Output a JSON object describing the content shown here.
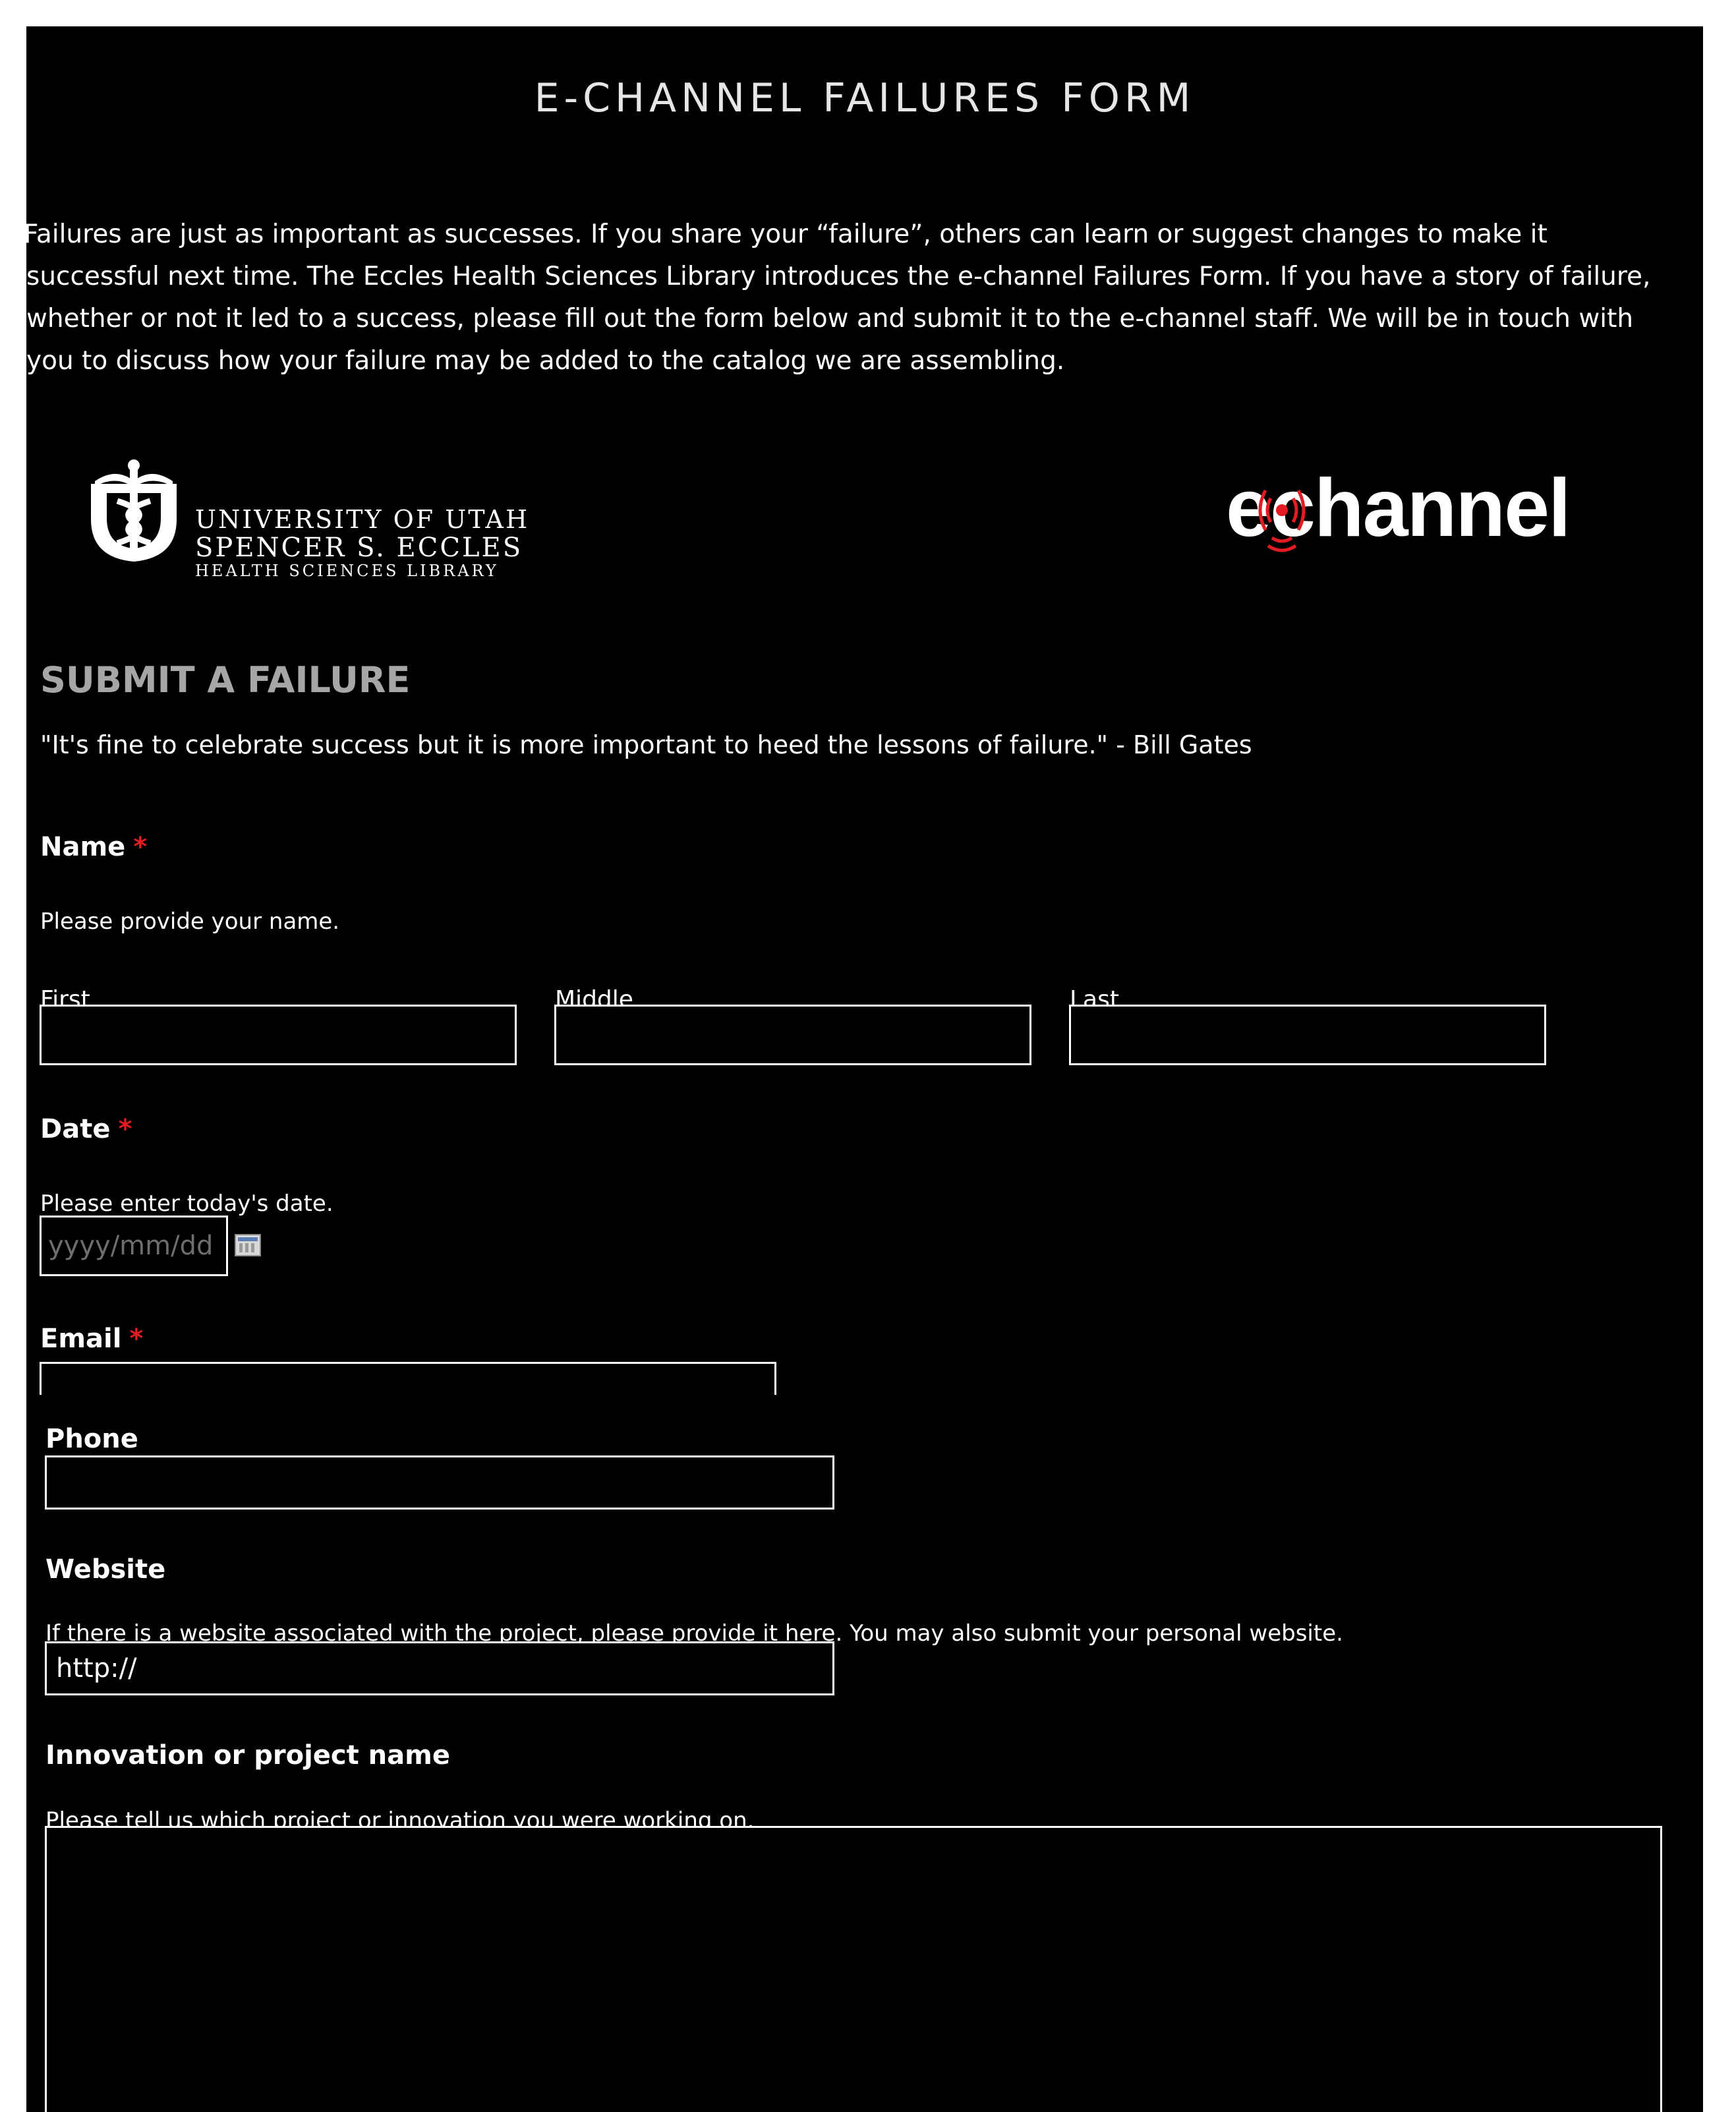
{
  "header": {
    "title": "E-CHANNEL FAILURES FORM",
    "intro": "Failures are just as important as successes. If you share your “failure”, others can learn or suggest changes to make it successful next time. The Eccles Health Sciences Library introduces the e-channel Failures Form. If you have a story of failure, whether or not it led to a success, please fill out the form below and submit it to the e-channel staff. We will be in touch with you to discuss how your failure may be added to the catalog we are assembling."
  },
  "logos": {
    "library": {
      "line1": "UNIVERSITY OF UTAH",
      "line2": "SPENCER S. ECCLES",
      "line3": "HEALTH SCIENCES LIBRARY"
    },
    "echannel": {
      "text": "echannel",
      "accent_color": "#e31b23"
    }
  },
  "form": {
    "section_title": "SUBMIT A FAILURE",
    "quote": "\"It's fine to celebrate success but it is more important to heed the lessons of failure.\" - Bill Gates",
    "required_marker": "*",
    "name": {
      "label": "Name",
      "description": "Please provide your name.",
      "first_label": "First",
      "middle_label": "Middle",
      "last_label": "Last",
      "first_value": "",
      "middle_value": "",
      "last_value": ""
    },
    "date": {
      "label": "Date",
      "description": "Please enter today's date.",
      "placeholder": "yyyy/mm/dd",
      "value": ""
    },
    "email": {
      "label": "Email",
      "value": ""
    },
    "phone": {
      "label": "Phone",
      "value": ""
    },
    "website": {
      "label": "Website",
      "description": "If there is a website associated with the project, please provide it here. You may also submit your personal website.",
      "value": "http://"
    },
    "project": {
      "label": "Innovation or project name",
      "description": "Please tell us which project or innovation you were working on.",
      "value": ""
    }
  },
  "colors": {
    "background": "#000000",
    "text": "#ffffff",
    "section_title": "#a6a6a6",
    "required": "#e31b23"
  }
}
